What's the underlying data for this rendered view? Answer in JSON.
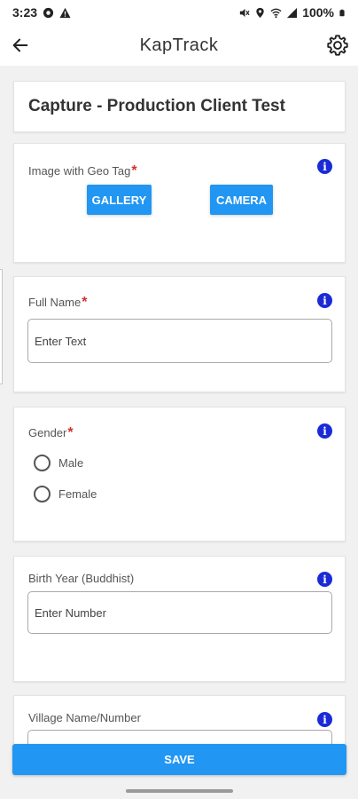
{
  "status_bar": {
    "time": "3:23",
    "battery": "100%",
    "left_icons": [
      "settings-status-icon",
      "warning-icon"
    ],
    "right_icons": [
      "mute-icon",
      "location-icon",
      "wifi-icon",
      "signal-icon",
      "battery-icon"
    ]
  },
  "app_bar": {
    "title": "KapTrack",
    "back_icon": "arrow-left-icon",
    "settings_icon": "gear-icon"
  },
  "form": {
    "title": "Capture - Production Client Test",
    "image_field": {
      "label": "Image with Geo Tag",
      "required_mark": "*",
      "gallery_label": "GALLERY",
      "camera_label": "CAMERA"
    },
    "full_name": {
      "label": "Full Name",
      "required_mark": "*",
      "value": "Enter Text"
    },
    "gender": {
      "label": "Gender",
      "required_mark": "*",
      "options": [
        "Male",
        "Female"
      ]
    },
    "birth_year": {
      "label": "Birth Year (Buddhist)",
      "value": "Enter Number"
    },
    "village": {
      "label": "Village Name/Number"
    },
    "info_glyph": "i"
  },
  "save_label": "SAVE",
  "colors": {
    "accent": "#2196f3",
    "info": "#1a2bd6",
    "required": "#d32f2f"
  }
}
